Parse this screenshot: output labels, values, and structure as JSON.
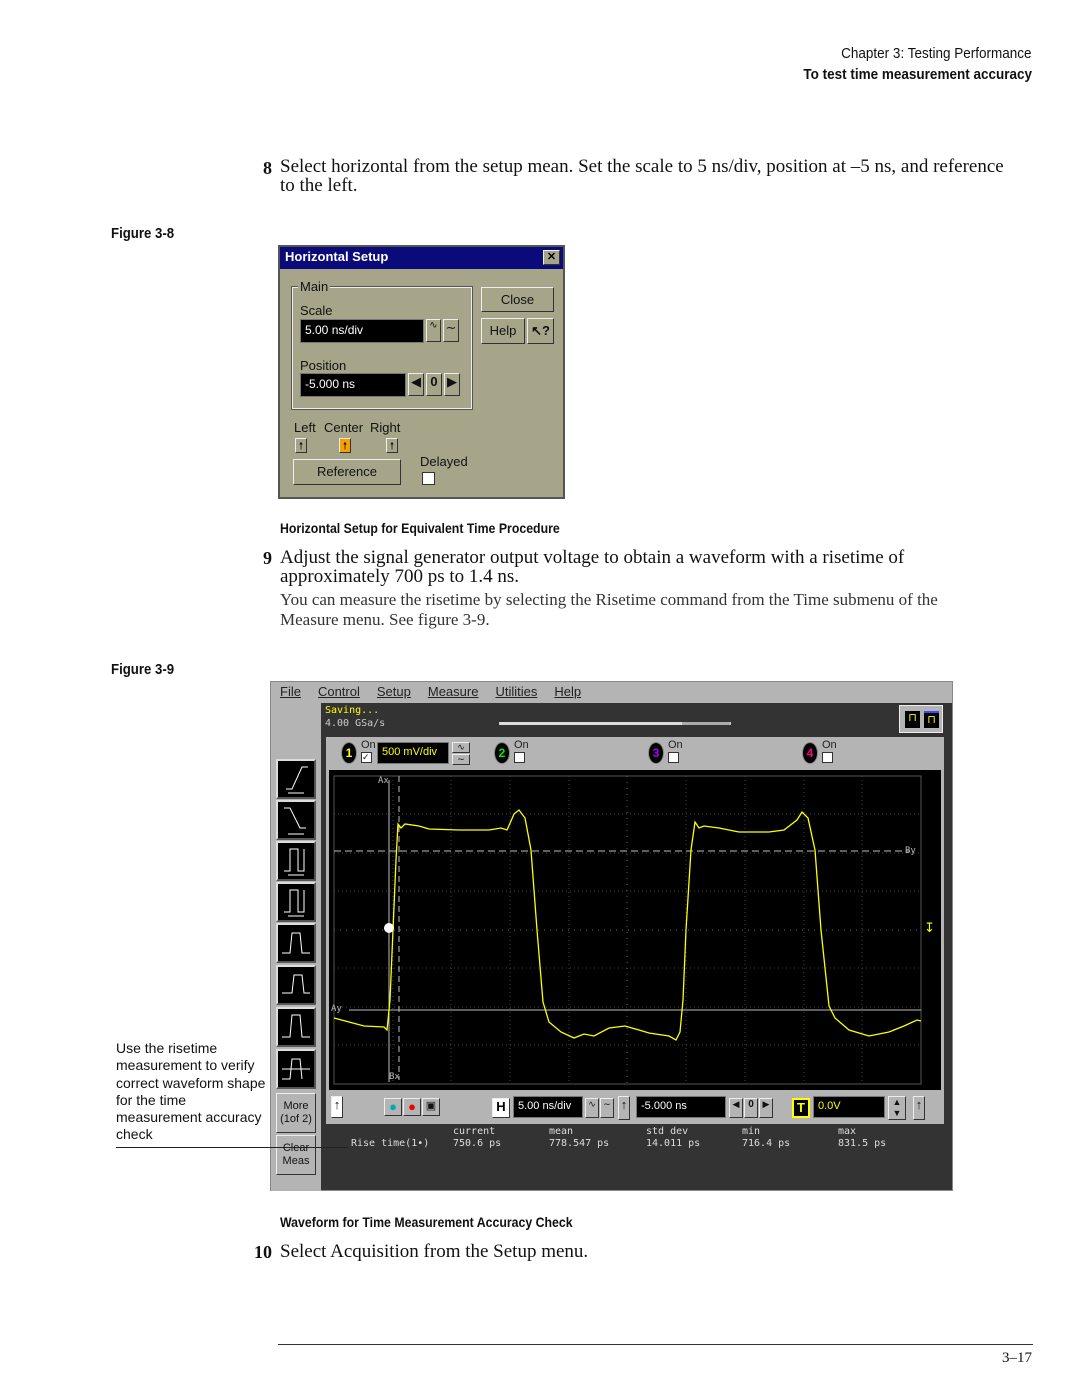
{
  "header": {
    "chapter": "Chapter 3: Testing Performance",
    "section": "To test time measurement accuracy"
  },
  "steps": [
    {
      "num": "8",
      "text": "Select horizontal from the setup mean. Set the scale to 5 ns/div, position at –5 ns, and reference to the left."
    },
    {
      "num": "9",
      "text": "Adjust the signal generator output voltage to obtain a waveform with a risetime of approximately 700 ps to 1.4 ns.",
      "note": "You can measure the risetime by selecting the Risetime command from the Time submenu of the Measure menu. See figure 3-9."
    },
    {
      "num": "10",
      "text": "Select Acquisition from the Setup menu."
    }
  ],
  "fig8": {
    "label": "Figure 3-8",
    "caption": "Horizontal Setup for Equivalent Time Procedure",
    "dialog": {
      "title": "Horizontal Setup",
      "close_x": "✕",
      "group": "Main",
      "scale_label": "Scale",
      "scale_value": "5.00 ns/div",
      "position_label": "Position",
      "position_value": "-5.000 ns",
      "zero": "0",
      "close": "Close",
      "help": "Help",
      "whats_this": "↖?",
      "ref_left": "Left",
      "ref_center": "Center",
      "ref_right": "Right",
      "ref_selected": "left",
      "reference": "Reference",
      "delayed": "Delayed"
    }
  },
  "fig9": {
    "label": "Figure 3-9",
    "caption": "Waveform for Time Measurement Accuracy Check",
    "side_note": "Use the risetime measurement to verify correct waveform shape for the time measurement accuracy check",
    "menu": [
      "File",
      "Control",
      "Setup",
      "Measure",
      "Utilities",
      "Help"
    ],
    "status": "Saving...",
    "sample_rate": "4.00 GSa/s",
    "channels": [
      {
        "n": "1",
        "on": true,
        "color": "#ffff00",
        "scale": "500 mV/div"
      },
      {
        "n": "2",
        "on": false,
        "color": "#00e000"
      },
      {
        "n": "3",
        "on": false,
        "color": "#a000ff"
      },
      {
        "n": "4",
        "on": false,
        "color": "#ff0080"
      }
    ],
    "on_label": "On",
    "markers": {
      "ax": "Ax",
      "bx": "Bx",
      "ay": "Ay",
      "by": "By"
    },
    "more": "More (1of 2)",
    "clear": "Clear Meas",
    "h_label": "H",
    "h_scale": "5.00 ns/div",
    "h_pos": "-5.000 ns",
    "zero": "0",
    "t_label": "T",
    "trig_level": "0.0V",
    "meas": {
      "name": "Rise time(1•)",
      "headers": [
        "current",
        "mean",
        "std dev",
        "min",
        "max"
      ],
      "values": [
        "750.6 ps",
        "778.547 ps",
        "14.011 ps",
        "716.4 ps",
        "831.5 ps"
      ]
    },
    "colors": {
      "trace": "#ffff00",
      "dialog_bg": "#a6a58a",
      "titlebar": "#0a0a7a"
    }
  },
  "footer": {
    "page": "3–17"
  }
}
